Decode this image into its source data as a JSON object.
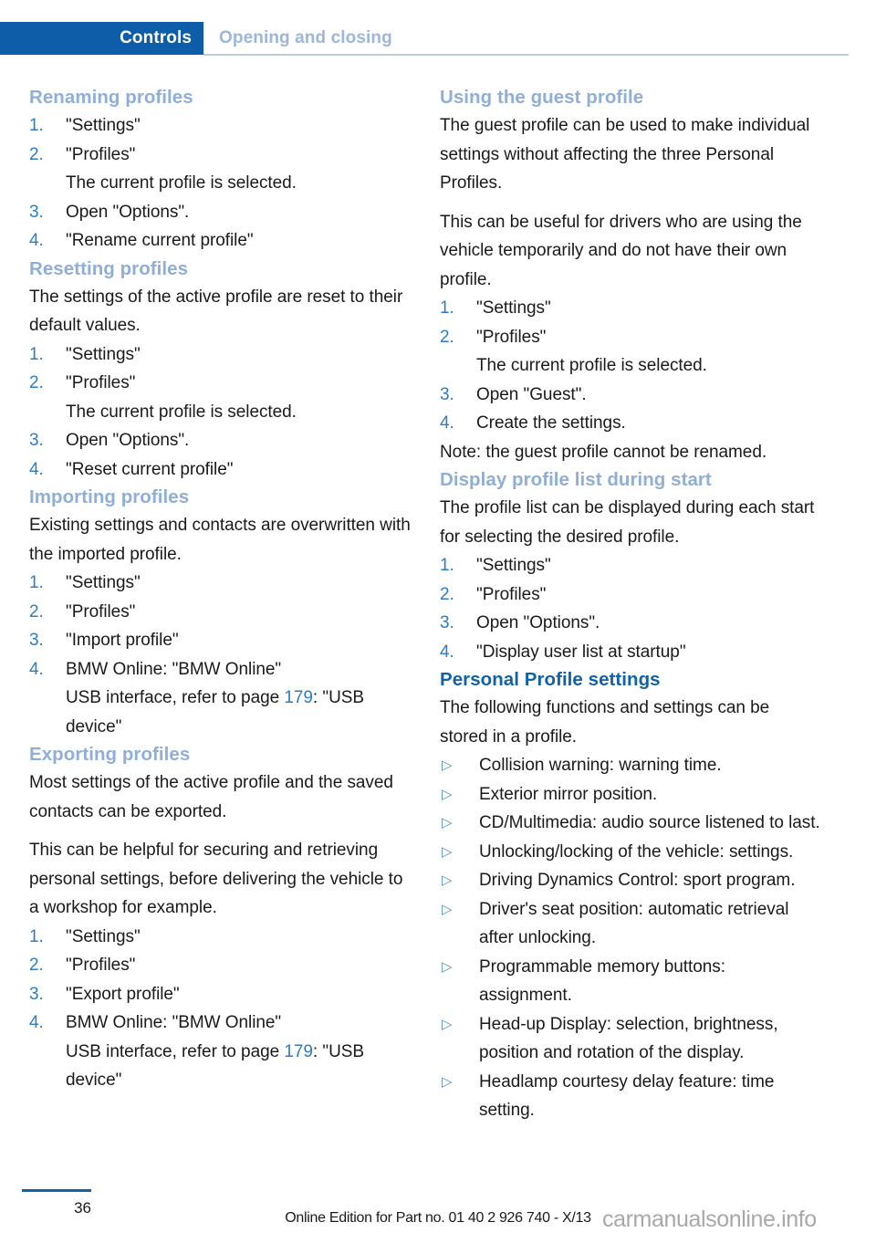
{
  "header": {
    "tab_label": "Controls",
    "section_label": "Opening and closing"
  },
  "left_column": {
    "sections": [
      {
        "heading": "Renaming profiles",
        "steps": [
          {
            "num": "1.",
            "text": "\"Settings\""
          },
          {
            "num": "2.",
            "text": "\"Profiles\""
          },
          {
            "num": "3.",
            "text": "Open \"Options\"."
          },
          {
            "num": "4.",
            "text": "\"Rename current profile\""
          }
        ],
        "subnote": "The current profile is selected."
      },
      {
        "heading": "Resetting profiles",
        "intro": "The settings of the active profile are reset to their default values.",
        "steps": [
          {
            "num": "1.",
            "text": "\"Settings\""
          },
          {
            "num": "2.",
            "text": "\"Profiles\""
          },
          {
            "num": "3.",
            "text": "Open \"Options\"."
          },
          {
            "num": "4.",
            "text": "\"Reset current profile\""
          }
        ],
        "subnote": "The current profile is selected."
      },
      {
        "heading": "Importing profiles",
        "intro": "Existing settings and contacts are overwritten with the imported profile.",
        "steps": [
          {
            "num": "1.",
            "text": "\"Settings\""
          },
          {
            "num": "2.",
            "text": "\"Profiles\""
          },
          {
            "num": "3.",
            "text": "\"Import profile\""
          },
          {
            "num": "4.",
            "text": "BMW Online: \"BMW Online\""
          }
        ],
        "usb_prefix": "USB interface, refer to page ",
        "usb_pageref": "179",
        "usb_suffix": ": \"USB device\""
      },
      {
        "heading": "Exporting profiles",
        "intro1": "Most settings of the active profile and the saved contacts can be exported.",
        "intro2": "This can be helpful for securing and retrieving personal settings, before delivering the vehicle to a workshop for example.",
        "steps": [
          {
            "num": "1.",
            "text": "\"Settings\""
          },
          {
            "num": "2.",
            "text": "\"Profiles\""
          },
          {
            "num": "3.",
            "text": "\"Export profile\""
          },
          {
            "num": "4.",
            "text": "BMW Online: \"BMW Online\""
          }
        ],
        "usb_prefix": "USB interface, refer to page ",
        "usb_pageref": "179",
        "usb_suffix": ": \"USB device\""
      }
    ]
  },
  "right_column": {
    "sections": [
      {
        "heading": "Using the guest profile",
        "intro1": "The guest profile can be used to make individual settings without affecting the three Personal Profiles.",
        "intro2": "This can be useful for drivers who are using the vehicle temporarily and do not have their own profile.",
        "steps": [
          {
            "num": "1.",
            "text": "\"Settings\""
          },
          {
            "num": "2.",
            "text": "\"Profiles\""
          },
          {
            "num": "3.",
            "text": "Open \"Guest\"."
          },
          {
            "num": "4.",
            "text": "Create the settings."
          }
        ],
        "subnote": "The current profile is selected.",
        "note": "Note: the guest profile cannot be renamed."
      },
      {
        "heading": "Display profile list during start",
        "intro": "The profile list can be displayed during each start for selecting the desired profile.",
        "steps": [
          {
            "num": "1.",
            "text": "\"Settings\""
          },
          {
            "num": "2.",
            "text": "\"Profiles\""
          },
          {
            "num": "3.",
            "text": "Open \"Options\"."
          },
          {
            "num": "4.",
            "text": "\"Display user list at startup\""
          }
        ]
      },
      {
        "heading": "Personal Profile settings",
        "intro": "The following functions and settings can be stored in a profile.",
        "bullets": [
          "Collision warning: warning time.",
          "Exterior mirror position.",
          "CD/Multimedia: audio source listened to last.",
          "Unlocking/locking of the vehicle: settings.",
          "Driving Dynamics Control: sport program.",
          "Driver's seat position: automatic retrieval after unlocking.",
          "Programmable memory buttons: assignment.",
          "Head-up Display: selection, brightness, position and rotation of the display.",
          "Headlamp courtesy delay feature: time setting."
        ],
        "bullet_marker": "triangle-right-icon"
      }
    ]
  },
  "footer": {
    "page_number": "36",
    "edition_text": "Online Edition for Part no. 01 40 2 926 740 - X/13",
    "watermark": "carmanualsonline.info"
  },
  "colors": {
    "tab_blue": "#0d5da8",
    "section_label_blue": "#9db6dc",
    "heading_blue": "#8faed8",
    "major_heading_blue": "#1163a8",
    "number_blue": "#2e7cc3",
    "rule_blue": "#b9cde8",
    "footer_rule_blue": "#1163a8",
    "watermark_gray": "#a8a8a8"
  }
}
